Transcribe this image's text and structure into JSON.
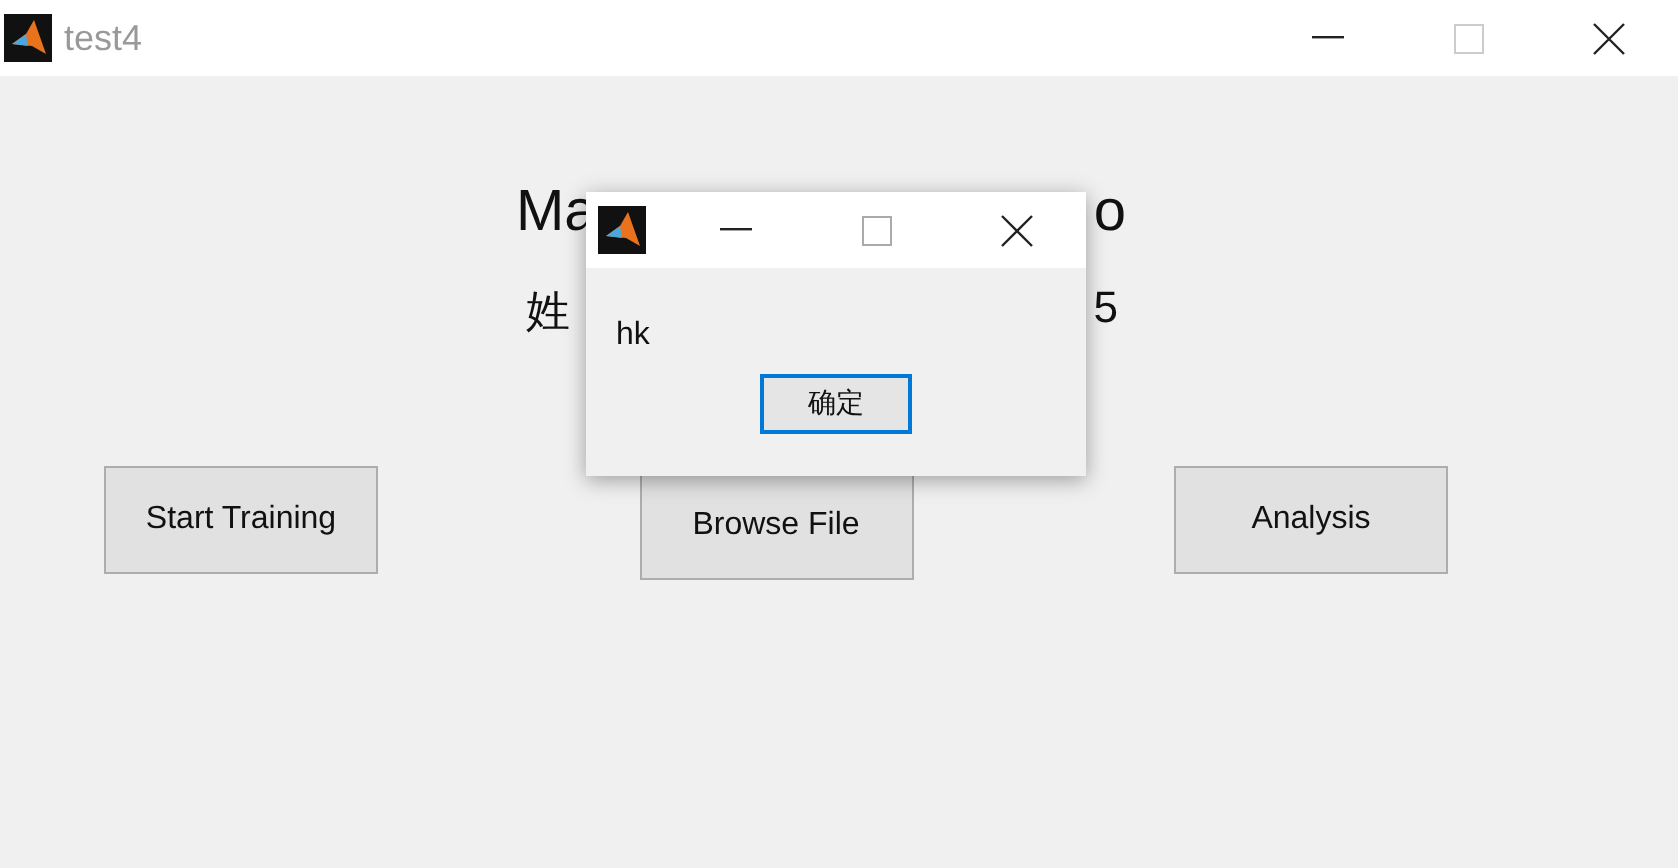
{
  "window": {
    "title": "test4"
  },
  "heading_fragments": [
    "Ma",
    "o"
  ],
  "subtitle_fragments": [
    "姓",
    "5"
  ],
  "buttons": [
    {
      "label": "Start Training"
    },
    {
      "label": "Browse File"
    },
    {
      "label": "Analysis"
    }
  ],
  "dialog": {
    "message": "hk",
    "button": {
      "label": "确定",
      "focused": true
    }
  }
}
